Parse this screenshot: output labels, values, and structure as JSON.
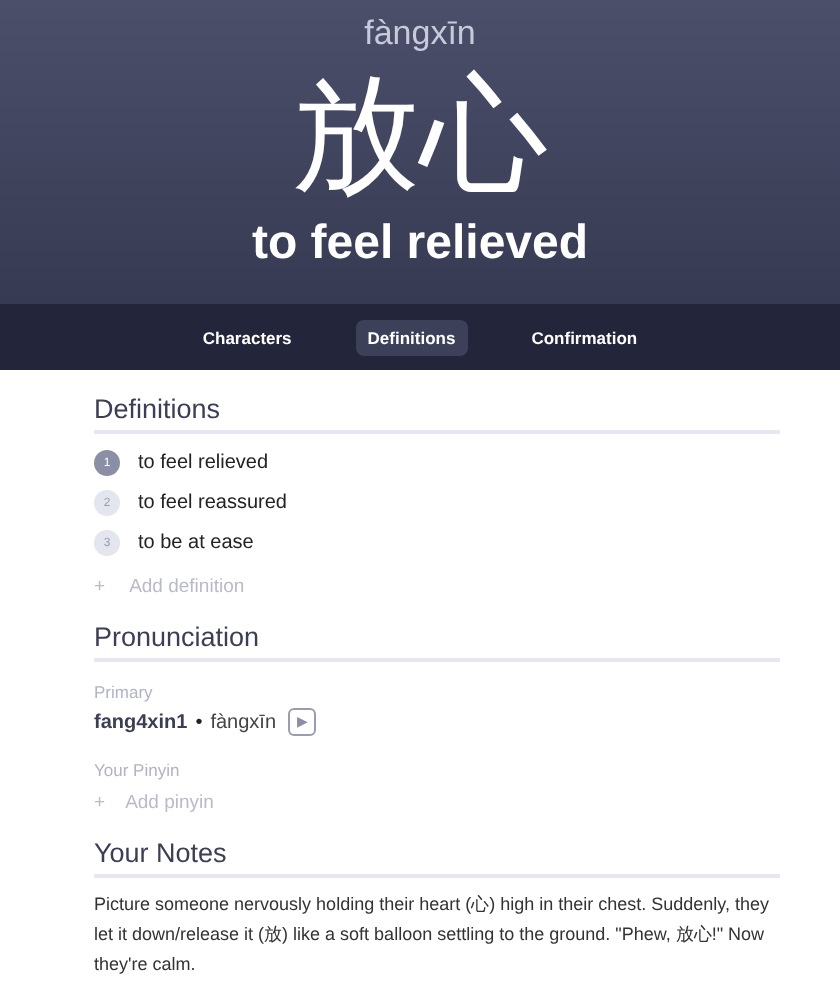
{
  "header": {
    "pinyin": "fàngxīn",
    "characters": "放心",
    "meaning": "to feel relieved"
  },
  "tabs": [
    {
      "label": "Characters",
      "selected": false
    },
    {
      "label": "Definitions",
      "selected": true
    },
    {
      "label": "Confirmation",
      "selected": false
    }
  ],
  "definitions": {
    "title": "Definitions",
    "items": [
      {
        "number": "1",
        "text": "to feel relieved",
        "selected": true
      },
      {
        "number": "2",
        "text": "to feel reassured",
        "selected": false
      },
      {
        "number": "3",
        "text": "to be at ease",
        "selected": false
      }
    ],
    "add_icon": "+",
    "add_label": "Add definition"
  },
  "pronunciation": {
    "title": "Pronunciation",
    "primary_label": "Primary",
    "primary_code": "fang4xin1",
    "separator": "•",
    "primary_pinyin": "fàngxīn",
    "play_icon": "▶",
    "your_label": "Your Pinyin",
    "add_icon": "+",
    "add_label": "Add pinyin"
  },
  "notes": {
    "title": "Your Notes",
    "text": "Picture someone nervously holding their heart (心) high in their chest. Suddenly, they let it down/release it (放) like a soft balloon settling to the ground. \"Phew, 放心!\" Now they're calm."
  }
}
